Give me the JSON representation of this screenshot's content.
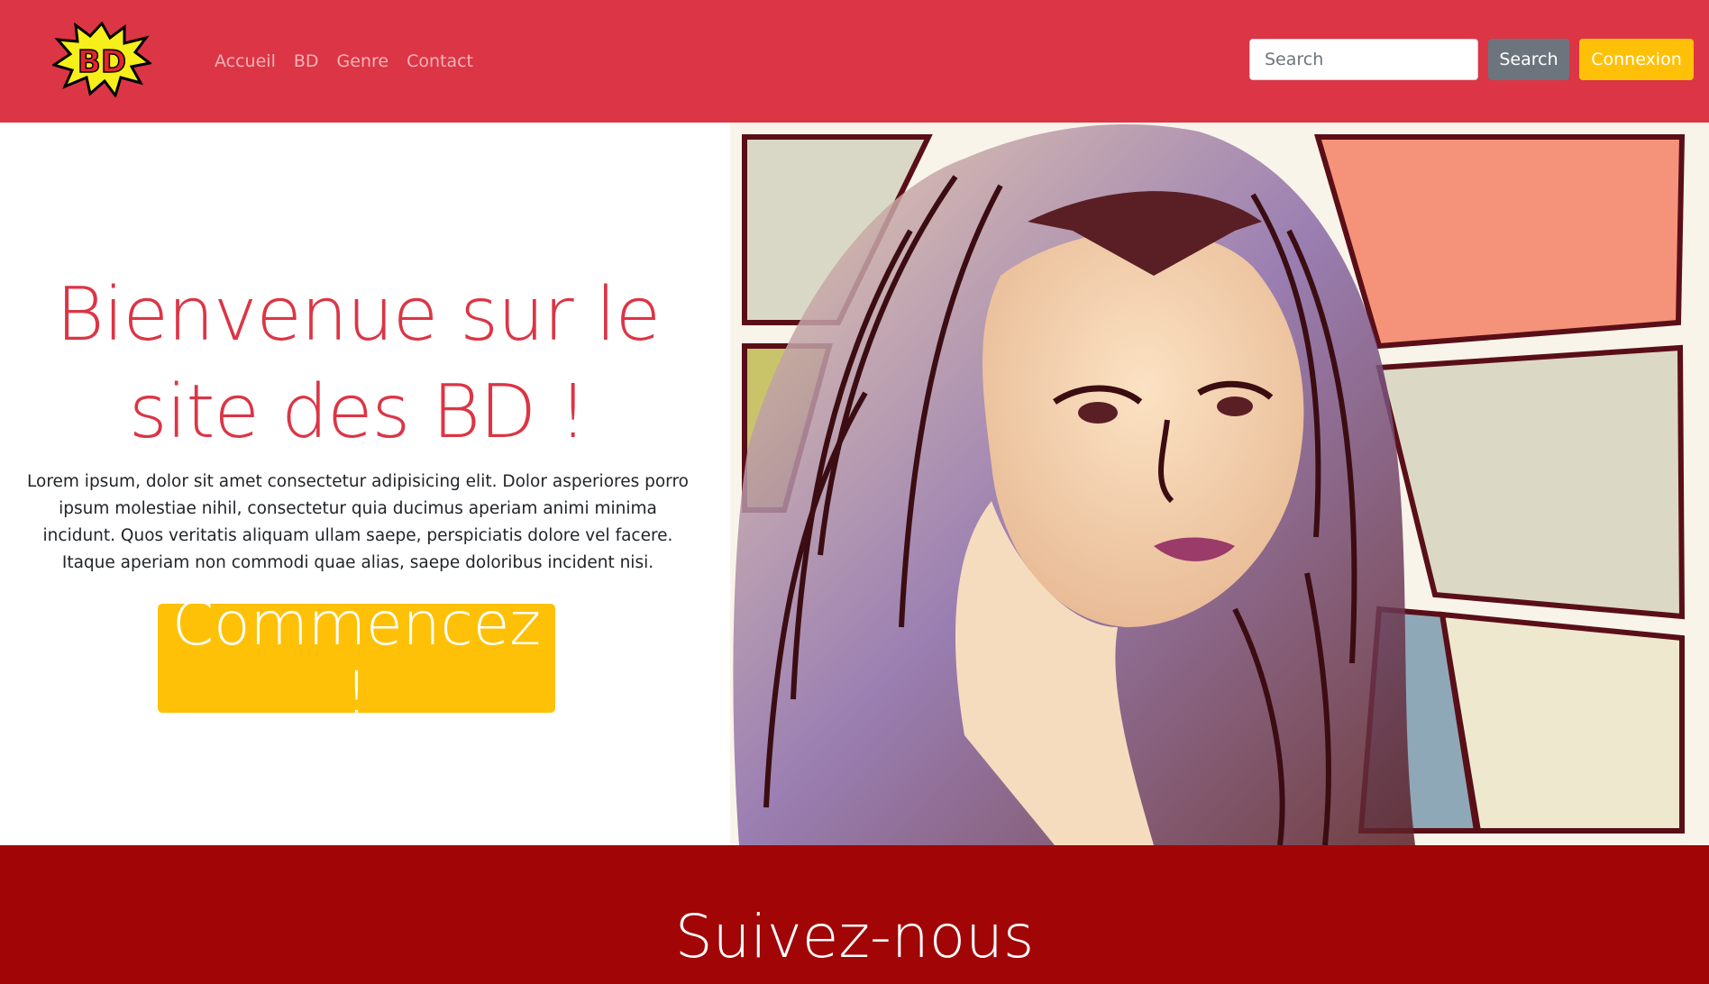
{
  "navbar": {
    "brand_logo_text": "BD",
    "links": [
      "Accueil",
      "BD",
      "Genre",
      "Contact"
    ],
    "search_placeholder": "Search",
    "search_button": "Search",
    "login_button": "Connexion"
  },
  "hero": {
    "title": "Bienvenue sur le site des BD !",
    "text": "Lorem ipsum, dolor sit amet consectetur adipisicing elit. Dolor asperiores porro ipsum molestiae nihil, consectetur quia ducimus aperiam animi minima incidunt. Quos veritatis aliquam ullam saepe, perspiciatis dolore vel facere. Itaque aperiam non commodi quae alias, saepe doloribus incident nisi.",
    "cta_button": "Commencez !"
  },
  "follow": {
    "title": "Suivez-nous"
  },
  "colors": {
    "primary": "#dc3545",
    "warning": "#ffc107",
    "secondary": "#6c757d",
    "dark_red": "#a10506"
  },
  "icons": {
    "logo": "comic-burst-logo"
  }
}
